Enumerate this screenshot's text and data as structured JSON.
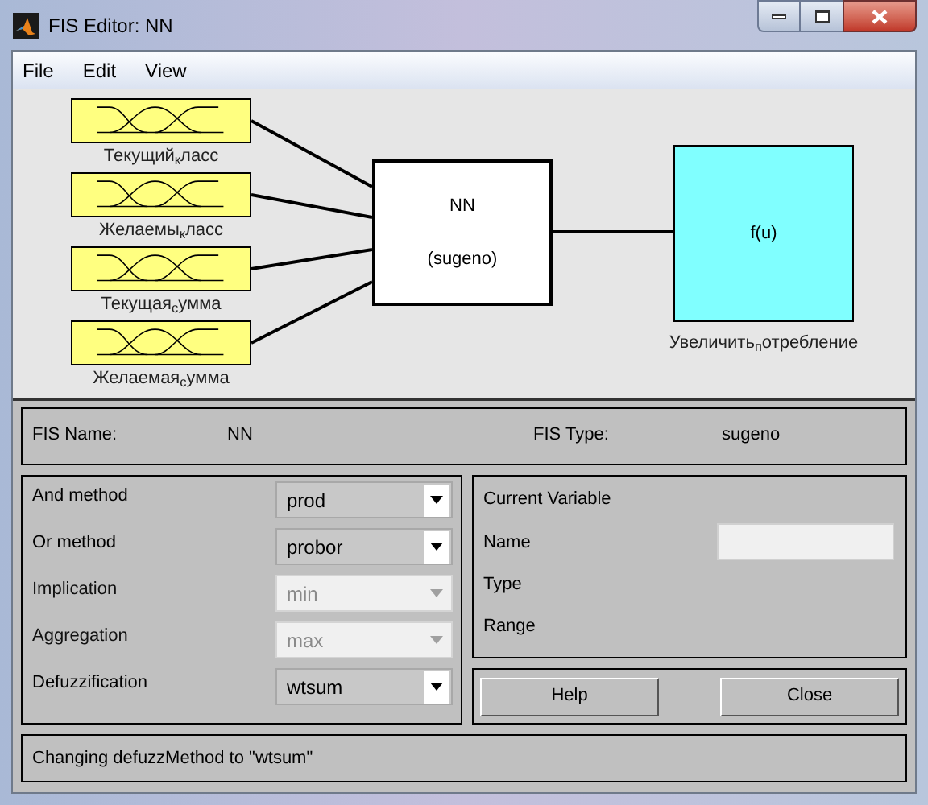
{
  "window": {
    "title": "FIS Editor: NN"
  },
  "menu": [
    "File",
    "Edit",
    "View"
  ],
  "diagram": {
    "inputs": [
      {
        "label": "Текущий$_{к}$ласс"
      },
      {
        "label": "Желаемы$_{к}$ласс"
      },
      {
        "label": "Текущая$_{с}$умма"
      },
      {
        "label": "Желаемая$_{с}$умма"
      }
    ],
    "system": {
      "name": "NN",
      "type": "(sugeno)"
    },
    "output": {
      "function": "f(u)",
      "label": "Увеличить$_{п}$отребление"
    }
  },
  "fis_info": {
    "name_label": "FIS Name:",
    "name": "NN",
    "type_label": "FIS Type:",
    "type": "sugeno"
  },
  "methods": [
    {
      "label": "And method",
      "value": "prod",
      "disabled": false
    },
    {
      "label": "Or method",
      "value": "probor",
      "disabled": false
    },
    {
      "label": "Implication",
      "value": "min",
      "disabled": true
    },
    {
      "label": "Aggregation",
      "value": "max",
      "disabled": true
    },
    {
      "label": "Defuzzification",
      "value": "wtsum",
      "disabled": false
    }
  ],
  "current_variable": {
    "title": "Current Variable",
    "fields": [
      {
        "label": "Name",
        "kind": "input"
      },
      {
        "label": "Type",
        "kind": "text"
      },
      {
        "label": "Range",
        "kind": "text"
      }
    ]
  },
  "buttons": [
    "Help",
    "Close"
  ],
  "status": "Changing defuzzMethod to \"wtsum\""
}
